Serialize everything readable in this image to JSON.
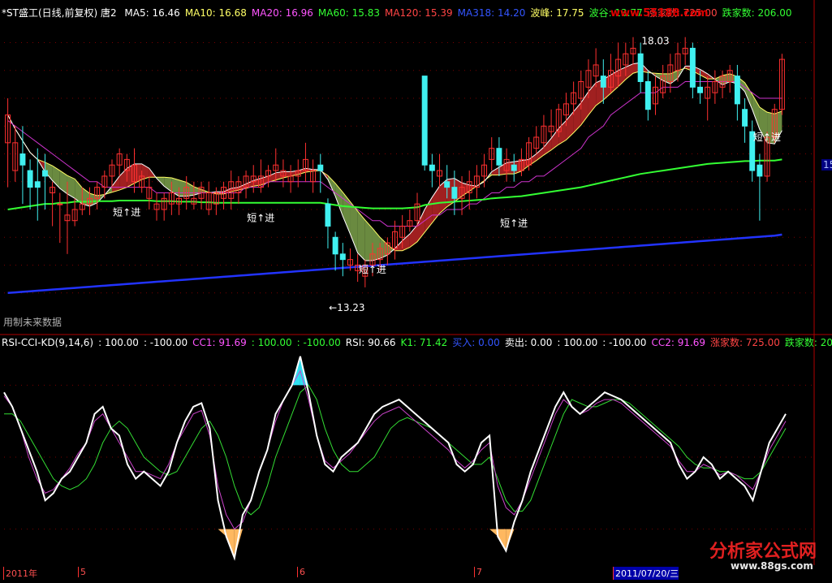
{
  "header": {
    "title": "*ST盛工(日线,前复权) 唐2",
    "ma": [
      {
        "label": "MA5: 16.46",
        "color": "#ffffff"
      },
      {
        "label": "MA10: 16.68",
        "color": "#ffff66"
      },
      {
        "label": "MA20: 16.96",
        "color": "#ff55ff"
      },
      {
        "label": "MA60: 15.83",
        "color": "#33ff33"
      },
      {
        "label": "MA120: 15.39",
        "color": "#ff4444"
      },
      {
        "label": "MA318: 14.20",
        "color": "#3355ff"
      },
      {
        "label": "波峰: 17.75",
        "color": "#ffff66"
      },
      {
        "label": "波谷: 13.77",
        "color": "#33ff33"
      },
      {
        "label": "涨家数: 725.00",
        "color": "#ff4444"
      },
      {
        "label": "跌家数: 206.00",
        "color": "#33ff33"
      }
    ]
  },
  "watermark_top": "www.55188.com",
  "lower_header": [
    {
      "label": "RSI-CCI-KD(9,14,6)",
      "color": "#ffffff"
    },
    {
      "label": ": 100.00",
      "color": "#ffffff"
    },
    {
      "label": ": -100.00",
      "color": "#ffffff"
    },
    {
      "label": "CC1: 91.69",
      "color": "#ff55ff"
    },
    {
      "label": ": 100.00",
      "color": "#33ff33"
    },
    {
      "label": ": -100.00",
      "color": "#33ff33"
    },
    {
      "label": "RSI: 90.66",
      "color": "#ffffff"
    },
    {
      "label": "K1: 71.42",
      "color": "#33ff33"
    },
    {
      "label": "买入: 0.00",
      "color": "#3355ff"
    },
    {
      "label": "卖出: 0.00",
      "color": "#ffffff"
    },
    {
      "label": ": 100.00",
      "color": "#ffffff"
    },
    {
      "label": ": -100.00",
      "color": "#ffffff"
    },
    {
      "label": "CC2: 91.69",
      "color": "#ff55ff"
    },
    {
      "label": "涨家数: 725.00",
      "color": "#ff4444"
    },
    {
      "label": "跌家数: 206.00",
      "color": "#33ff33"
    }
  ],
  "no_future_note": "用制未来数据",
  "right_edge_value": "15",
  "brand": {
    "name": "分析家公式网",
    "url": "www.88gs.com"
  },
  "x_axis_labels": [
    "2011年",
    "5",
    "6",
    "7",
    "2011/07/20/三"
  ],
  "colors": {
    "up": "#ff3030",
    "down": "#40f0f0",
    "red_band": "#a02020",
    "green_band": "#6a8a40"
  },
  "chart_data": {
    "type": "candlestick",
    "ylim": [
      13.0,
      18.3
    ],
    "candles": [
      [
        16.2,
        17.0,
        16.7,
        15.4
      ],
      [
        15.7,
        16.5,
        16.2,
        15.5
      ],
      [
        16.0,
        16.5,
        15.8,
        15.1
      ],
      [
        15.7,
        15.9,
        15.4,
        15.0
      ],
      [
        15.5,
        16.1,
        15.4,
        14.8
      ],
      [
        15.7,
        16.0,
        15.6,
        15.0
      ],
      [
        15.3,
        15.5,
        15.4,
        14.7
      ],
      [
        15.1,
        15.3,
        15.1,
        14.4
      ],
      [
        14.8,
        15.5,
        14.9,
        14.2
      ],
      [
        14.8,
        15.2,
        15.0,
        14.7
      ],
      [
        15.0,
        15.4,
        15.1,
        14.9
      ],
      [
        15.1,
        15.4,
        15.2,
        14.9
      ],
      [
        15.2,
        15.5,
        15.4,
        15.0
      ],
      [
        15.4,
        15.7,
        15.6,
        15.2
      ],
      [
        15.6,
        15.9,
        15.8,
        15.4
      ],
      [
        15.8,
        16.1,
        16.0,
        15.6
      ],
      [
        15.7,
        16.0,
        15.9,
        15.5
      ],
      [
        15.5,
        16.1,
        15.8,
        15.3
      ],
      [
        15.4,
        15.7,
        15.6,
        15.3
      ],
      [
        15.2,
        15.6,
        15.4,
        15.0
      ],
      [
        15.0,
        15.3,
        15.1,
        14.8
      ],
      [
        15.0,
        15.3,
        15.2,
        14.8
      ],
      [
        15.1,
        15.5,
        15.3,
        14.9
      ],
      [
        15.1,
        15.4,
        15.2,
        14.9
      ],
      [
        15.2,
        15.6,
        15.4,
        15.0
      ],
      [
        15.1,
        15.5,
        15.2,
        15.0
      ],
      [
        15.2,
        15.5,
        15.4,
        15.0
      ],
      [
        15.0,
        15.5,
        15.3,
        14.9
      ],
      [
        15.1,
        15.4,
        15.3,
        14.9
      ],
      [
        15.2,
        15.5,
        15.4,
        15.0
      ],
      [
        15.2,
        15.7,
        15.5,
        15.0
      ],
      [
        15.3,
        15.6,
        15.5,
        15.1
      ],
      [
        15.4,
        15.7,
        15.6,
        15.2
      ],
      [
        15.5,
        15.8,
        15.6,
        15.3
      ],
      [
        15.4,
        15.9,
        15.6,
        15.3
      ],
      [
        15.6,
        15.8,
        15.7,
        15.4
      ],
      [
        15.7,
        16.1,
        15.8,
        15.5
      ],
      [
        15.6,
        15.9,
        15.7,
        15.4
      ],
      [
        15.5,
        15.8,
        15.6,
        15.3
      ],
      [
        15.6,
        15.9,
        15.7,
        15.4
      ],
      [
        15.7,
        16.2,
        15.9,
        15.5
      ],
      [
        15.5,
        15.9,
        15.7,
        15.3
      ],
      [
        15.8,
        16.0,
        15.7,
        15.3
      ],
      [
        15.1,
        15.2,
        14.7,
        14.3
      ],
      [
        14.5,
        14.6,
        14.2,
        13.9
      ],
      [
        14.2,
        14.4,
        14.1,
        13.8
      ],
      [
        14.0,
        14.3,
        14.1,
        13.9
      ],
      [
        13.9,
        14.2,
        14.0,
        13.7
      ],
      [
        13.8,
        14.1,
        14.0,
        13.6
      ],
      [
        14.0,
        14.4,
        14.2,
        13.8
      ],
      [
        14.1,
        14.4,
        14.3,
        13.9
      ],
      [
        14.2,
        14.5,
        14.4,
        14.0
      ],
      [
        14.3,
        14.8,
        14.6,
        14.1
      ],
      [
        14.5,
        14.9,
        14.7,
        14.3
      ],
      [
        14.7,
        15.0,
        14.8,
        14.6
      ],
      [
        14.8,
        15.3,
        15.1,
        14.7
      ],
      [
        17.4,
        17.4,
        15.8,
        15.7
      ],
      [
        15.8,
        16.0,
        15.7,
        15.4
      ],
      [
        15.6,
        16.0,
        15.7,
        15.4
      ],
      [
        15.5,
        15.8,
        15.4,
        15.2
      ],
      [
        15.4,
        15.7,
        15.2,
        14.9
      ],
      [
        15.2,
        15.6,
        15.4,
        14.9
      ],
      [
        15.3,
        15.7,
        15.5,
        15.0
      ],
      [
        15.4,
        15.8,
        15.6,
        15.2
      ],
      [
        15.6,
        16.0,
        15.8,
        15.4
      ],
      [
        15.9,
        16.3,
        16.1,
        15.7
      ],
      [
        16.1,
        16.3,
        15.8,
        15.6
      ],
      [
        15.7,
        16.1,
        15.9,
        15.5
      ],
      [
        15.8,
        16.0,
        15.7,
        15.5
      ],
      [
        15.7,
        16.1,
        15.9,
        15.6
      ],
      [
        15.8,
        16.3,
        16.2,
        15.7
      ],
      [
        16.1,
        16.5,
        16.3,
        16.0
      ],
      [
        16.2,
        16.7,
        16.5,
        16.1
      ],
      [
        16.4,
        16.8,
        16.5,
        16.3
      ],
      [
        16.4,
        16.9,
        16.8,
        16.3
      ],
      [
        16.7,
        17.1,
        16.9,
        16.5
      ],
      [
        16.9,
        17.3,
        17.1,
        16.7
      ],
      [
        17.0,
        17.5,
        17.3,
        16.8
      ],
      [
        17.2,
        17.7,
        17.5,
        17.0
      ],
      [
        17.4,
        17.9,
        17.6,
        17.2
      ],
      [
        17.4,
        17.7,
        17.2,
        16.9
      ],
      [
        17.2,
        17.8,
        17.5,
        17.1
      ],
      [
        17.4,
        18.0,
        17.7,
        17.2
      ],
      [
        17.6,
        18.0,
        17.8,
        17.4
      ],
      [
        17.8,
        18.1,
        17.9,
        17.6
      ],
      [
        17.8,
        18.0,
        17.3,
        17.1
      ],
      [
        17.3,
        17.5,
        16.8,
        16.6
      ],
      [
        16.9,
        17.4,
        17.2,
        16.7
      ],
      [
        17.1,
        17.6,
        17.4,
        17.0
      ],
      [
        17.3,
        17.8,
        17.6,
        17.1
      ],
      [
        17.5,
        18.0,
        17.8,
        17.3
      ],
      [
        17.8,
        18.1,
        17.9,
        17.6
      ],
      [
        17.9,
        18.0,
        17.2,
        17.0
      ],
      [
        17.2,
        17.5,
        17.1,
        16.9
      ],
      [
        17.0,
        17.4,
        17.2,
        16.6
      ],
      [
        17.1,
        17.5,
        17.3,
        16.9
      ],
      [
        17.2,
        17.5,
        17.4,
        17.0
      ],
      [
        17.3,
        17.6,
        17.5,
        17.1
      ],
      [
        17.4,
        17.6,
        16.9,
        16.6
      ],
      [
        16.8,
        17.0,
        16.5,
        16.2
      ],
      [
        16.4,
        16.6,
        15.7,
        15.5
      ],
      [
        15.8,
        16.0,
        15.6,
        14.8
      ],
      [
        15.6,
        16.4,
        16.3,
        15.5
      ],
      [
        16.3,
        16.9,
        16.8,
        16.2
      ],
      [
        16.8,
        17.8,
        17.7,
        16.7
      ]
    ],
    "ma_lines": {
      "ma20": [
        16.6,
        16.5,
        16.4,
        16.3,
        16.2,
        16.1,
        16.0,
        15.9,
        15.8,
        15.7,
        15.6,
        15.5,
        15.5,
        15.4,
        15.4,
        15.4,
        15.4,
        15.4,
        15.4,
        15.4,
        15.3,
        15.3,
        15.3,
        15.3,
        15.3,
        15.3,
        15.3,
        15.3,
        15.3,
        15.3,
        15.3,
        15.3,
        15.4,
        15.4,
        15.4,
        15.5,
        15.5,
        15.5,
        15.5,
        15.5,
        15.5,
        15.5,
        15.5,
        15.4,
        15.3,
        15.2,
        15.1,
        15.0,
        14.9,
        14.8,
        14.8,
        14.7,
        14.7,
        14.7,
        14.7,
        14.7,
        14.8,
        14.9,
        14.9,
        15.0,
        15.0,
        15.0,
        15.1,
        15.1,
        15.2,
        15.3,
        15.3,
        15.4,
        15.4,
        15.5,
        15.5,
        15.6,
        15.6,
        15.7,
        15.8,
        15.9,
        16.0,
        16.1,
        16.3,
        16.4,
        16.5,
        16.7,
        16.8,
        16.9,
        17.0,
        17.1,
        17.1,
        17.1,
        17.2,
        17.2,
        17.2,
        17.3,
        17.3,
        17.3,
        17.3,
        17.3,
        17.3,
        17.3,
        17.3,
        17.2,
        17.1,
        17.0,
        17.0,
        17.0,
        17.0
      ],
      "ma60": [
        15.0,
        15.02,
        15.04,
        15.06,
        15.08,
        15.1,
        15.1,
        15.12,
        15.12,
        15.14,
        15.14,
        15.14,
        15.15,
        15.15,
        15.15,
        15.16,
        15.16,
        15.16,
        15.16,
        15.16,
        15.15,
        15.15,
        15.15,
        15.14,
        15.14,
        15.14,
        15.13,
        15.13,
        15.12,
        15.12,
        15.12,
        15.12,
        15.12,
        15.12,
        15.12,
        15.12,
        15.12,
        15.12,
        15.12,
        15.12,
        15.12,
        15.12,
        15.12,
        15.1,
        15.08,
        15.06,
        15.05,
        15.04,
        15.03,
        15.02,
        15.02,
        15.02,
        15.02,
        15.02,
        15.03,
        15.04,
        15.08,
        15.1,
        15.12,
        15.13,
        15.14,
        15.15,
        15.16,
        15.17,
        15.18,
        15.2,
        15.21,
        15.22,
        15.23,
        15.24,
        15.26,
        15.28,
        15.3,
        15.32,
        15.34,
        15.36,
        15.38,
        15.4,
        15.43,
        15.46,
        15.49,
        15.52,
        15.55,
        15.58,
        15.61,
        15.64,
        15.66,
        15.68,
        15.7,
        15.72,
        15.74,
        15.76,
        15.78,
        15.8,
        15.82,
        15.83,
        15.84,
        15.85,
        15.86,
        15.87,
        15.87,
        15.88,
        15.88,
        15.88,
        15.9
      ],
      "ma318": [
        13.5,
        13.51,
        13.52,
        13.53,
        13.54,
        13.55,
        13.56,
        13.57,
        13.58,
        13.59,
        13.6,
        13.61,
        13.62,
        13.63,
        13.64,
        13.65,
        13.66,
        13.67,
        13.68,
        13.69,
        13.7,
        13.71,
        13.72,
        13.73,
        13.74,
        13.75,
        13.76,
        13.77,
        13.78,
        13.79,
        13.8,
        13.81,
        13.82,
        13.83,
        13.84,
        13.85,
        13.86,
        13.87,
        13.88,
        13.89,
        13.9,
        13.91,
        13.92,
        13.93,
        13.94,
        13.95,
        13.96,
        13.97,
        13.98,
        13.99,
        14.0,
        14.01,
        14.02,
        14.03,
        14.04,
        14.05,
        14.06,
        14.07,
        14.08,
        14.09,
        14.1,
        14.11,
        14.12,
        14.13,
        14.14,
        14.15,
        14.16,
        14.17,
        14.18,
        14.19,
        14.2,
        14.21,
        14.22,
        14.23,
        14.24,
        14.25,
        14.26,
        14.27,
        14.28,
        14.29,
        14.3,
        14.31,
        14.32,
        14.33,
        14.34,
        14.35,
        14.36,
        14.37,
        14.38,
        14.39,
        14.4,
        14.41,
        14.42,
        14.43,
        14.44,
        14.45,
        14.46,
        14.47,
        14.48,
        14.49,
        14.5,
        14.51,
        14.52,
        14.53,
        14.55
      ]
    },
    "annotations": [
      {
        "text": "短↑进",
        "index": 15,
        "price": 14.95
      },
      {
        "text": "短↑进",
        "index": 33,
        "price": 14.85
      },
      {
        "text": "短↑进",
        "index": 48,
        "price": 13.92
      },
      {
        "text": "短↑进",
        "index": 67,
        "price": 14.75
      },
      {
        "text": "短↑进",
        "index": 101,
        "price": 16.3
      },
      {
        "text": "18.03",
        "index": 86,
        "price": 18.03
      },
      {
        "text": "←13.23",
        "index": 44,
        "price": 13.23
      }
    ],
    "oscillator": {
      "ylim": [
        -150,
        150
      ],
      "levels": [
        100,
        -100
      ],
      "rsi": [
        90,
        70,
        40,
        10,
        -20,
        -60,
        -50,
        -30,
        -20,
        0,
        20,
        60,
        70,
        40,
        30,
        -10,
        -30,
        -20,
        -30,
        -40,
        -20,
        20,
        50,
        70,
        75,
        40,
        -60,
        -110,
        -140,
        -80,
        -60,
        -20,
        10,
        60,
        80,
        100,
        140,
        90,
        30,
        -10,
        -20,
        0,
        10,
        20,
        40,
        60,
        70,
        75,
        80,
        70,
        60,
        50,
        40,
        30,
        20,
        -10,
        -20,
        -10,
        20,
        30,
        -110,
        -130,
        -90,
        -60,
        -20,
        10,
        40,
        70,
        90,
        70,
        60,
        70,
        80,
        90,
        85,
        80,
        70,
        60,
        50,
        40,
        30,
        20,
        -10,
        -30,
        -20,
        0,
        -10,
        -30,
        -20,
        -30,
        -40,
        -60,
        -20,
        20,
        40,
        60
      ],
      "cc1": [
        85,
        70,
        40,
        0,
        -30,
        -50,
        -45,
        -30,
        -15,
        5,
        20,
        50,
        60,
        40,
        20,
        0,
        -20,
        -20,
        -25,
        -30,
        -10,
        20,
        40,
        60,
        65,
        30,
        -40,
        -80,
        -100,
        -90,
        -60,
        -20,
        10,
        50,
        80,
        100,
        120,
        80,
        30,
        -5,
        -15,
        -5,
        5,
        20,
        35,
        50,
        60,
        65,
        70,
        60,
        50,
        40,
        30,
        20,
        10,
        -5,
        -15,
        -5,
        10,
        20,
        -40,
        -70,
        -80,
        -60,
        -30,
        0,
        30,
        60,
        80,
        70,
        60,
        65,
        75,
        80,
        80,
        75,
        65,
        55,
        45,
        35,
        25,
        15,
        -5,
        -20,
        -20,
        -10,
        -15,
        -25,
        -20,
        -25,
        -35,
        -45,
        -20,
        10,
        30,
        50
      ],
      "k1": [
        60,
        60,
        50,
        30,
        10,
        -10,
        -30,
        -40,
        -45,
        -40,
        -30,
        -10,
        20,
        40,
        50,
        40,
        20,
        0,
        -10,
        -20,
        -25,
        -20,
        0,
        20,
        40,
        50,
        30,
        0,
        -40,
        -70,
        -80,
        -70,
        -40,
        0,
        30,
        60,
        90,
        100,
        80,
        40,
        10,
        -10,
        -20,
        -20,
        -10,
        0,
        20,
        40,
        50,
        55,
        50,
        45,
        40,
        30,
        20,
        10,
        0,
        -10,
        -10,
        0,
        -30,
        -60,
        -75,
        -75,
        -60,
        -30,
        0,
        30,
        60,
        80,
        75,
        70,
        70,
        75,
        80,
        80,
        75,
        65,
        55,
        45,
        35,
        25,
        15,
        0,
        -10,
        -15,
        -15,
        -20,
        -20,
        -25,
        -30,
        -30,
        -20,
        0,
        20,
        40
      ]
    }
  }
}
